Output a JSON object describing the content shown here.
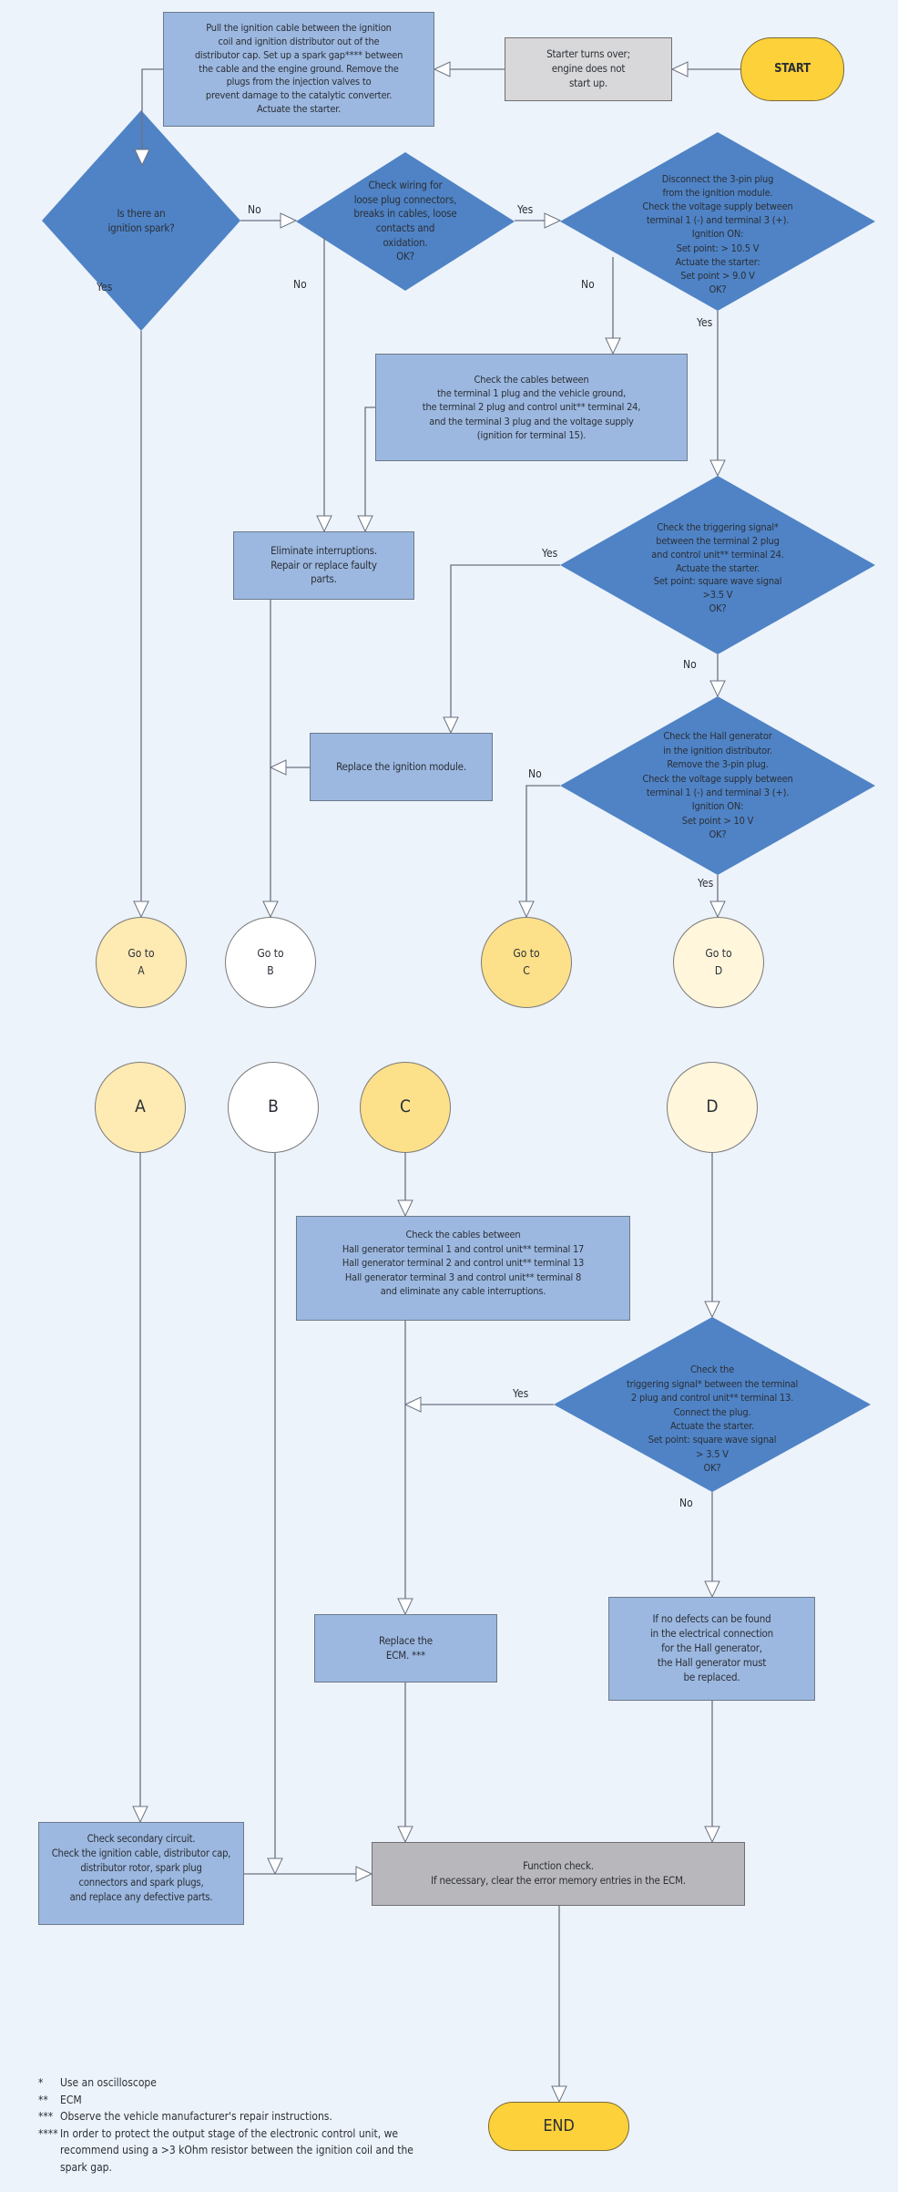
{
  "colors": {
    "background": "#edf3fa",
    "decision_blue": "#4f83c6",
    "action_box_blue": "#9cb8e0",
    "terminal_yellow": "#fdd139",
    "connector_a": "#feeab3",
    "connector_b": "#ffffff",
    "connector_c": "#fde08a",
    "connector_d": "#fff6dc",
    "start_box_grey": "#d8d8da",
    "function_check_grey": "#b8b8bc",
    "line": "#6b7280"
  },
  "nodes": {
    "start": "START",
    "starter": "Starter turns over;\nengine does not\nstart up.",
    "pull_cable": "Pull the ignition cable between the ignition\ncoil and ignition distributor out of the\ndistributor cap. Set up a spark gap**** between\nthe cable and the engine ground. Remove the\nplugs from the injection valves to\nprevent damage to the catalytic converter.\nActuate the starter.",
    "is_spark": "Is there an\nignition spark?",
    "check_wiring": "Check wiring for\nloose plug connectors,\nbreaks in cables, loose\ncontacts and\noxidation.\nOK?",
    "disconnect_plug": "Disconnect the 3-pin plug\nfrom the ignition module.\nCheck the voltage supply between\nterminal 1 (-) and terminal 3 (+).\nIgnition ON:\nSet point: > 10.5 V\nActuate the starter:\nSet point > 9.0 V\nOK?",
    "check_cables_terminal": "Check the cables between\nthe terminal 1 plug and the vehicle ground,\nthe terminal 2 plug and control unit** terminal 24,\nand the terminal 3 plug and the voltage supply\n(ignition for terminal 15).",
    "eliminate_interruptions": "Eliminate interruptions.\nRepair or replace faulty\nparts.",
    "check_trigger_24": "Check the triggering signal*\nbetween the terminal 2 plug\nand control unit** terminal 24.\nActuate the starter.\nSet point: square wave signal\n>3.5 V\nOK?",
    "replace_ignition_module": "Replace the ignition module.",
    "check_hall": "Check the Hall generator\nin the ignition distributor.\nRemove the 3-pin plug.\nCheck the voltage supply between\nterminal 1 (-) and terminal 3 (+).\nIgnition ON:\nSet point > 10 V\nOK?",
    "goto_a": "Go to\nA",
    "goto_b": "Go to\nB",
    "goto_c": "Go to\nC",
    "goto_d": "Go to\nD",
    "conn_a": "A",
    "conn_b": "B",
    "conn_c": "C",
    "conn_d": "D",
    "check_cables_hall": "Check the cables between\nHall generator terminal 1 and control unit** terminal 17\nHall generator terminal 2 and control unit** terminal 13\nHall generator terminal 3 and control unit** terminal 8\nand eliminate any cable interruptions.",
    "check_trigger_13": "Check the\ntriggering signal* between the terminal\n2 plug and control unit** terminal 13.\nConnect the plug.\nActuate the starter.\nSet point: square wave signal\n> 3.5 V\nOK?",
    "replace_ecm": "Replace the\nECM. ***",
    "no_defects": "If no defects can be found\nin the electrical connection\nfor the Hall generator,\nthe Hall generator must\nbe replaced.",
    "check_secondary": "Check secondary circuit.\nCheck the ignition cable, distributor cap,\ndistributor rotor, spark plug\nconnectors and spark plugs,\nand replace any defective parts.",
    "function_check": "Function check.\nIf necessary, clear the error memory entries in the ECM.",
    "end": "END"
  },
  "edge_labels": {
    "spark_no": "No",
    "spark_yes": "Yes",
    "wiring_yes": "Yes",
    "wiring_no": "No",
    "disconnect_no": "No",
    "disconnect_yes": "Yes",
    "trigger24_yes": "Yes",
    "trigger24_no": "No",
    "hall_no": "No",
    "hall_yes": "Yes",
    "trigger13_yes": "Yes",
    "trigger13_no": "No"
  },
  "footnotes": [
    {
      "mark": "*",
      "text": "Use an oscilloscope"
    },
    {
      "mark": "**",
      "text": "ECM"
    },
    {
      "mark": "***",
      "text": "Observe the vehicle manufacturer's repair instructions."
    },
    {
      "mark": "****",
      "text": "In order to protect the output stage of the electronic control unit, we recommend using a >3 kOhm resistor between the ignition coil and the spark gap."
    }
  ]
}
